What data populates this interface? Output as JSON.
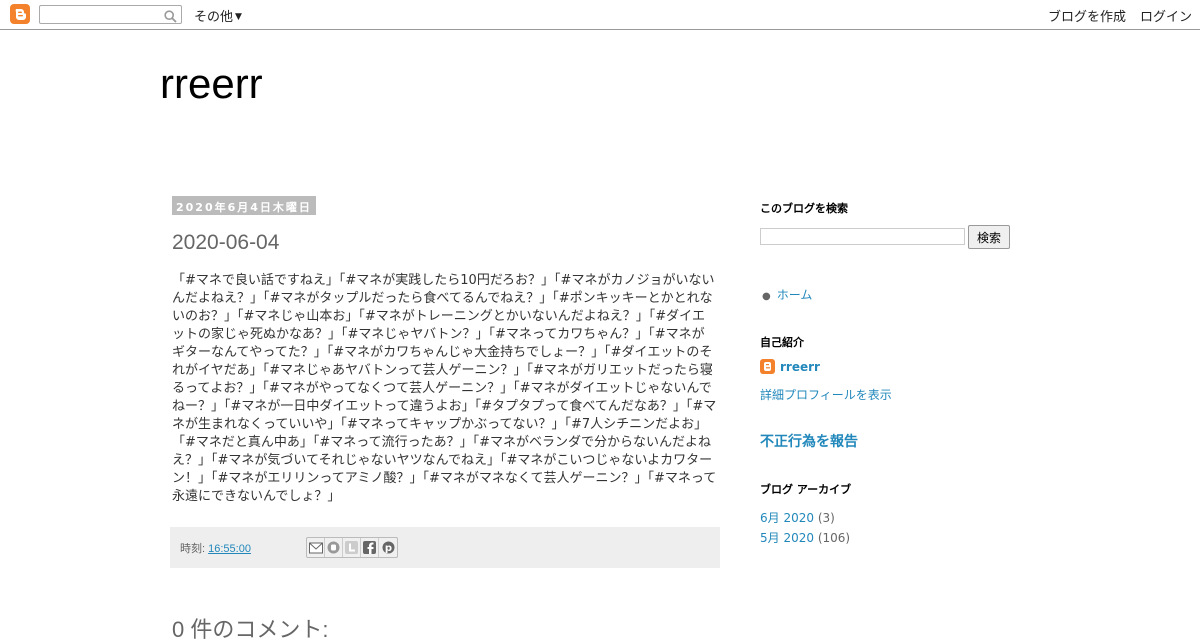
{
  "navbar": {
    "search_placeholder": "",
    "more_label": "その他",
    "create_blog": "ブログを作成",
    "login": "ログイン"
  },
  "blog": {
    "title": "rreerr"
  },
  "post": {
    "date_header": "2020年6月4日木曜日",
    "title": "2020-06-04",
    "body": "「#マネで良い話ですねえ」「#マネが実践したら10円だろお？」「#マネがカノジョがいないんだよねえ？」「#マネがタップルだったら食べてるんでねえ？」「#ポンキッキーとかとれないのお？」「#マネじゃ山本お」「#マネがトレーニングとかいないんだよねえ？」「#ダイエットの家じゃ死ぬかなあ？」「#マネじゃヤバトン？」「#マネってカワちゃん？」「#マネがギターなんてやってた？」「#マネがカワちゃんじゃ大金持ちでしょー？」「#ダイエットのそれがイヤだあ」「#マネじゃあヤバトンって芸人ゲーニン？」「#マネがガリエットだったら寝るってよお？」「#マネがやってなくつて芸人ゲーニン？」「#マネがダイエットじゃないんでねー？」「#マネが一日中ダイエットって違うよお」「#タプタプって食べてんだなあ？」「#マネが生まれなくっていいや」「#マネってキャップかぶってない？」「#7人シチニンだよお」「#マネだと真ん中あ」「#マネって流行ったあ？」「#マネがベランダで分からないんだよねえ？」「#マネが気づいてそれじゃないヤツなんでねえ」「#マネがこいつじゃないよカワターン！」「#マネがエリリンってアミノ酸？」「#マネがマネなくて芸人ゲーニン？」「#マネって永遠にできないんでしょ？」",
    "time_label": "時刻:",
    "time_value": "16:55:00",
    "share": [
      "mail-icon",
      "blogger-icon",
      "twitter-icon",
      "facebook-icon",
      "pinterest-icon"
    ],
    "comments_heading": "0 件のコメント:"
  },
  "sidebar": {
    "search_heading": "このブログを検索",
    "search_button": "検索",
    "home_link": "ホーム",
    "about_heading": "自己紹介",
    "profile_name": "rreerr",
    "profile_link": "詳細プロフィールを表示",
    "report_link": "不正行為を報告",
    "archive_heading": "ブログ アーカイブ",
    "archive": [
      {
        "label": "6月 2020",
        "count": "(3)"
      },
      {
        "label": "5月 2020",
        "count": "(106)"
      }
    ]
  },
  "colors": {
    "accent": "#2288bb",
    "brand": "#f4812b"
  }
}
